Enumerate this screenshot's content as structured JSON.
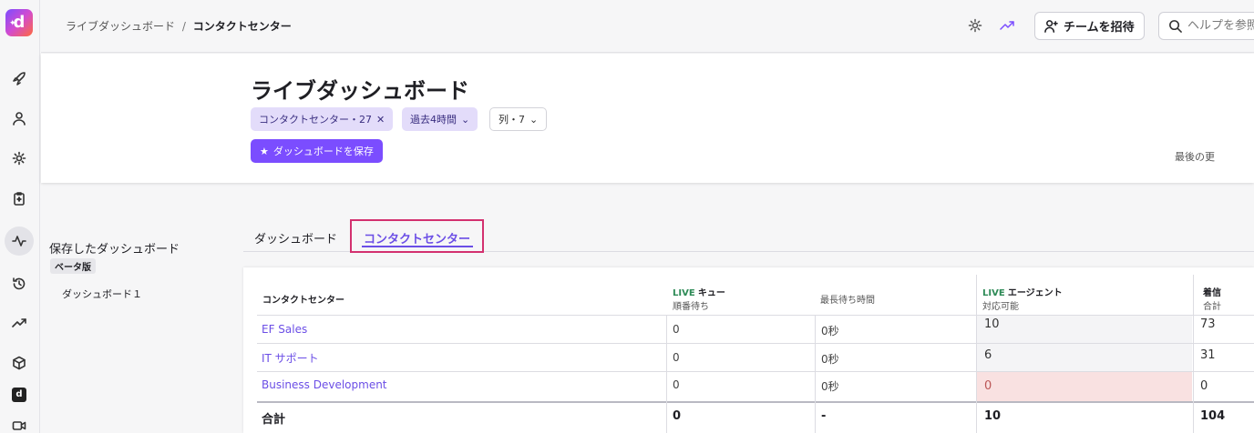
{
  "app": {
    "logo_letter": "d"
  },
  "breadcrumb": {
    "parent": "ライブダッシュボード",
    "separator": "/",
    "current": "コンタクトセンター"
  },
  "topbar": {
    "invite_label": "チームを招待",
    "help_placeholder": "ヘルプを参照"
  },
  "header": {
    "title": "ライブダッシュボード",
    "filter_chip": "コンタクトセンター・27",
    "time_chip": "過去4時間",
    "columns_chip": "列・7",
    "save_label": "ダッシュボードを保存",
    "updated_label": "最後の更"
  },
  "saved": {
    "title": "保存したダッシュボード",
    "badge": "ベータ版",
    "items": [
      "ダッシュボード１"
    ]
  },
  "tabs": [
    "ダッシュボード",
    "コンタクトセンター"
  ],
  "table": {
    "headers": {
      "center": "コンタクトセンター",
      "queue_live": "LIVE",
      "queue_title": "キュー",
      "queue_sub": "順番待ち",
      "max_wait": "最長待ち時間",
      "agent_live": "LIVE",
      "agent_title": "エージェント",
      "agent_sub": "対応可能",
      "incoming_title": "着信",
      "incoming_sub": "合計"
    },
    "rows": [
      {
        "name": "EF Sales",
        "waiting": "0",
        "max_wait": "0秒",
        "available": "10",
        "incoming": "73"
      },
      {
        "name": "IT サポート",
        "waiting": "0",
        "max_wait": "0秒",
        "available": "6",
        "incoming": "31"
      },
      {
        "name": "Business Development",
        "waiting": "0",
        "max_wait": "0秒",
        "available": "0",
        "incoming": "0"
      }
    ],
    "total": {
      "name": "合計",
      "waiting": "0",
      "max_wait": "-",
      "available": "10",
      "incoming": "104"
    }
  },
  "colors": {
    "accent": "#7b4dff",
    "link": "#6b4ee6",
    "live": "#2e8b57",
    "warn_bg": "#f9e1e1",
    "focus_border": "#d3316f"
  }
}
